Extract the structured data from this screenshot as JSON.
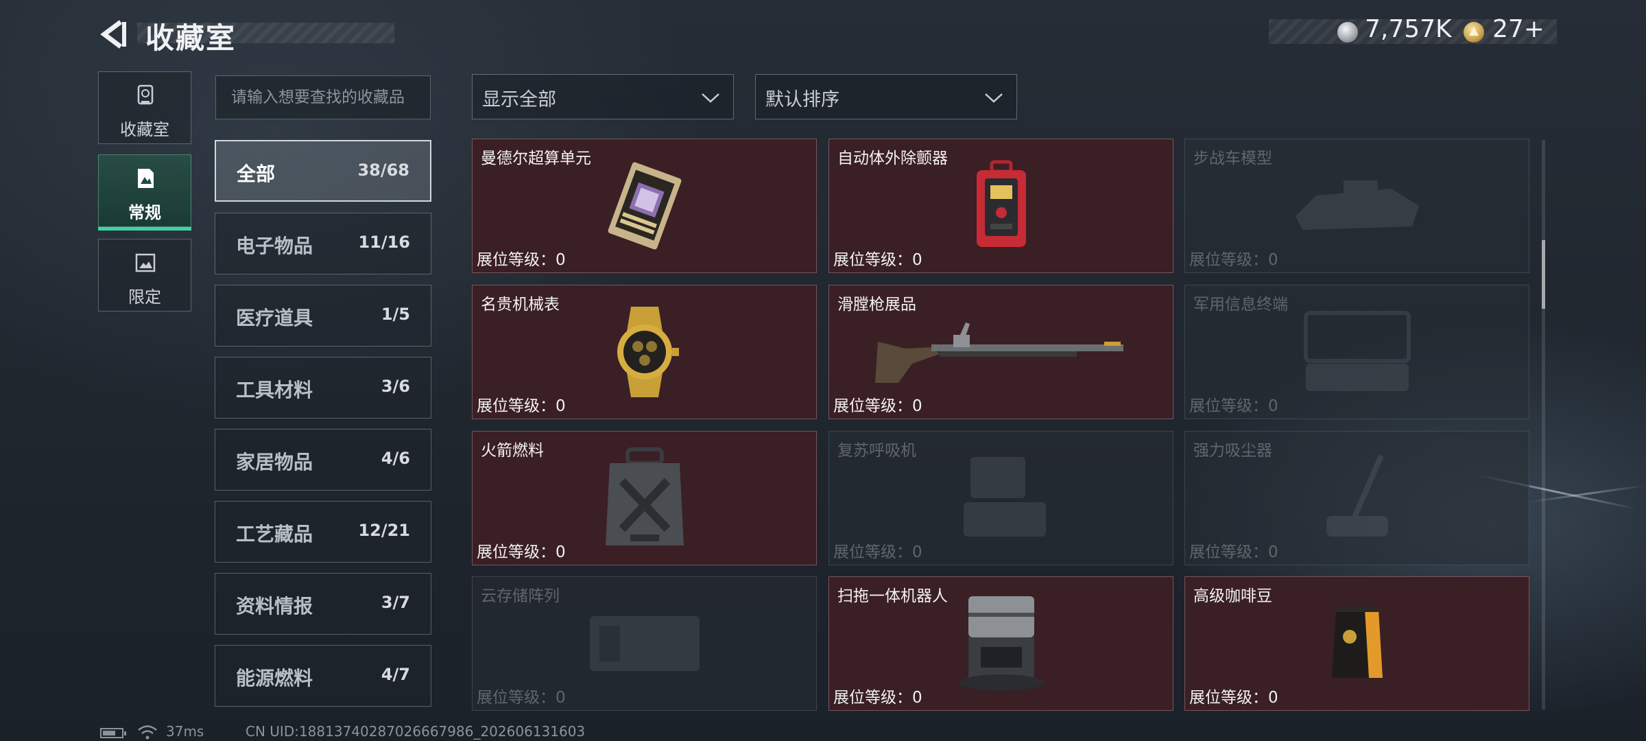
{
  "header": {
    "title": "收藏室",
    "currency_silver": "7,757K",
    "currency_gold": "27+"
  },
  "nav": [
    {
      "label": "收藏室",
      "icon": "trophy-icon",
      "active": false
    },
    {
      "label": "常规",
      "icon": "document-icon",
      "active": true
    },
    {
      "label": "限定",
      "icon": "image-icon",
      "active": false
    }
  ],
  "search": {
    "placeholder": "请输入想要查找的收藏品",
    "value": ""
  },
  "categories": [
    {
      "name": "全部",
      "count": "38/68",
      "active": true
    },
    {
      "name": "电子物品",
      "count": "11/16",
      "active": false
    },
    {
      "name": "医疗道具",
      "count": "1/5",
      "active": false
    },
    {
      "name": "工具材料",
      "count": "3/6",
      "active": false
    },
    {
      "name": "家居物品",
      "count": "4/6",
      "active": false
    },
    {
      "name": "工艺藏品",
      "count": "12/21",
      "active": false
    },
    {
      "name": "资料情报",
      "count": "3/7",
      "active": false
    },
    {
      "name": "能源燃料",
      "count": "4/7",
      "active": false
    }
  ],
  "filters": {
    "display": "显示全部",
    "sort": "默认排序"
  },
  "items": [
    {
      "name": "曼德尔超算单元",
      "level": "展位等级：0",
      "owned": true,
      "icon": "supercomputer-unit-icon"
    },
    {
      "name": "自动体外除颤器",
      "level": "展位等级：0",
      "owned": true,
      "icon": "defibrillator-icon"
    },
    {
      "name": "步战车模型",
      "level": "展位等级：0",
      "owned": false,
      "icon": "ifv-model-icon"
    },
    {
      "name": "名贵机械表",
      "level": "展位等级：0",
      "owned": true,
      "icon": "watch-icon"
    },
    {
      "name": "滑膛枪展品",
      "level": "展位等级：0",
      "owned": true,
      "icon": "musket-icon"
    },
    {
      "name": "军用信息终端",
      "level": "展位等级：0",
      "owned": false,
      "icon": "military-terminal-icon"
    },
    {
      "name": "火箭燃料",
      "level": "展位等级：0",
      "owned": true,
      "icon": "fuel-canister-icon"
    },
    {
      "name": "复苏呼吸机",
      "level": "展位等级：0",
      "owned": false,
      "icon": "ventilator-icon"
    },
    {
      "name": "强力吸尘器",
      "level": "展位等级：0",
      "owned": false,
      "icon": "vacuum-cleaner-icon"
    },
    {
      "name": "云存储阵列",
      "level": "展位等级：0",
      "owned": false,
      "icon": "storage-array-icon"
    },
    {
      "name": "扫拖一体机器人",
      "level": "展位等级：0",
      "owned": true,
      "icon": "robot-mop-icon"
    },
    {
      "name": "高级咖啡豆",
      "level": "展位等级：0",
      "owned": true,
      "icon": "coffee-bag-icon"
    }
  ],
  "footer": {
    "ping": "37ms",
    "uid": "CN UID:18813740287026667986_202606131603"
  },
  "colors": {
    "owned_card": "#3a1f25",
    "active_accent": "#3fd3a0"
  }
}
